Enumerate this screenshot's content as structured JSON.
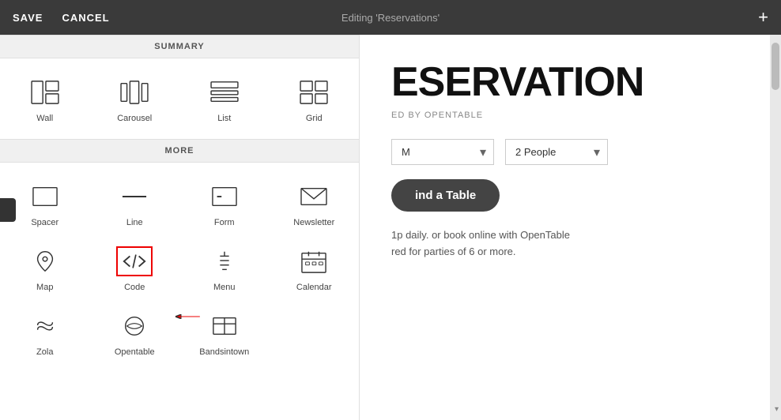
{
  "toolbar": {
    "save_label": "SAVE",
    "cancel_label": "CANCEL",
    "title": "Editing 'Reservations'",
    "plus_icon": "+"
  },
  "panel": {
    "summary_header": "SUMMARY",
    "more_header": "MORE",
    "summary_items": [
      {
        "id": "wall",
        "label": "Wall"
      },
      {
        "id": "carousel",
        "label": "Carousel"
      },
      {
        "id": "list",
        "label": "List"
      },
      {
        "id": "grid",
        "label": "Grid"
      }
    ],
    "more_items": [
      {
        "id": "spacer",
        "label": "Spacer"
      },
      {
        "id": "line",
        "label": "Line"
      },
      {
        "id": "form",
        "label": "Form"
      },
      {
        "id": "newsletter",
        "label": "Newsletter"
      },
      {
        "id": "map",
        "label": "Map"
      },
      {
        "id": "code",
        "label": "Code",
        "highlighted": true
      },
      {
        "id": "menu",
        "label": "Menu"
      },
      {
        "id": "calendar",
        "label": "Calendar"
      },
      {
        "id": "zola",
        "label": "Zola"
      },
      {
        "id": "opentable",
        "label": "Opentable"
      },
      {
        "id": "bandsintown",
        "label": "Bandsintown"
      }
    ]
  },
  "content": {
    "title": "ESERVATION",
    "powered_by": "ED BY OPENTABLE",
    "select_time": "M",
    "select_people": "2 People",
    "find_button": "ind a Table",
    "info_line1": "1p daily. or book online with OpenTable",
    "info_line2": "red for parties of 6 or more."
  }
}
